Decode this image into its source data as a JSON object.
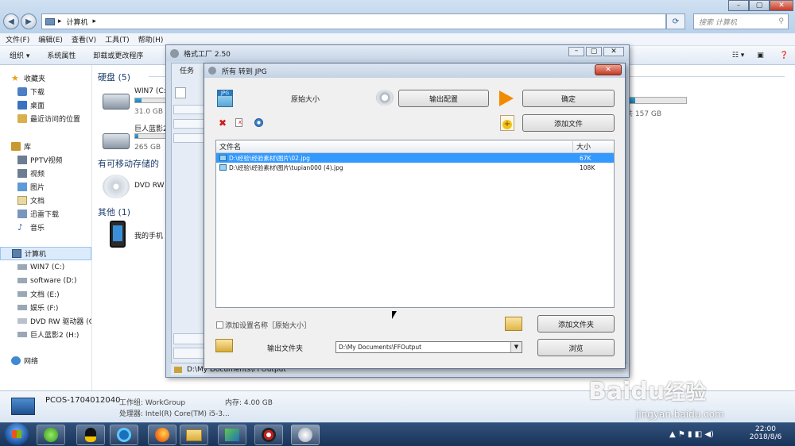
{
  "explorer": {
    "breadcrumb": "计算机",
    "search_placeholder": "搜索 计算机",
    "menu": [
      "文件(F)",
      "编辑(E)",
      "查看(V)",
      "工具(T)",
      "帮助(H)"
    ],
    "commands": [
      "组织 ▾",
      "系统属性",
      "卸载或更改程序"
    ],
    "sidebar": {
      "favorites_header": "收藏夹",
      "favorites": [
        "下载",
        "桌面",
        "最近访问的位置"
      ],
      "libraries_header": "库",
      "libraries": [
        "PPTV视频",
        "视频",
        "图片",
        "文档",
        "迅雷下载",
        "音乐"
      ],
      "computer_header": "计算机",
      "drives": [
        "WIN7 (C:)",
        "software (D:)",
        "文档 (E:)",
        "娱乐 (F:)",
        "DVD RW 驱动器 (G",
        "巨人蓝影2 (H:)"
      ],
      "network": "网络"
    },
    "groups": {
      "hard_disks": "硬盘 (5)",
      "removable": "有可移动存储的",
      "other": "其他 (1)"
    },
    "drives": [
      {
        "name": "WIN7 (C:",
        "size": "31.0 GB",
        "fill": 0.2
      },
      {
        "name": "巨人蓝影2",
        "size": "265 GB",
        "fill": 0.1
      }
    ],
    "drive_right_size": "共 157 GB",
    "dvd_label": "DVD RW",
    "phone_label": "我的手机",
    "details": {
      "pc_name": "PCOS-1704012040",
      "workgroup": "工作组: WorkGroup",
      "memory": "内存: 4.00 GB",
      "cpu": "处理器: Intel(R) Core(TM) i5-3..."
    },
    "clock": {
      "time": "22:00",
      "date": "2018/8/6"
    }
  },
  "formatfactory": {
    "title": "格式工厂 2.50",
    "sidebar_tab": "任务",
    "status_path": "D:\\My Documents\\FFOutput"
  },
  "dialog": {
    "title": "所有 转到 JPG",
    "jpg_badge": "JPG",
    "preset_label": "原始大小",
    "output_config_button": "输出配置",
    "ok_button": "确定",
    "add_file_button": "添加文件",
    "column_filename": "文件名",
    "column_size": "大小",
    "files": [
      {
        "name": "D:\\经验\\经验素材\\图片\\02.jpg",
        "size": "67K",
        "selected": true
      },
      {
        "name": "D:\\经验\\经验素材\\图片\\tupian000 (4).jpg",
        "size": "108K",
        "selected": false
      }
    ],
    "add_setting_checkbox_label": "添加设置名称［原始大小］",
    "add_folder_button": "添加文件夹",
    "output_folder_label": "输出文件夹",
    "output_folder_value": "D:\\My Documents\\FFOutput",
    "browse_button": "浏览"
  },
  "watermark": {
    "brand": "Baidu",
    "cn": "经验",
    "url": "jingyan.baidu.com"
  },
  "colors": {
    "accent": "#3399ff",
    "title_blue": "#1e3f6e",
    "ok_arrow": "#f28a00",
    "delete_red": "#d21a1a"
  }
}
